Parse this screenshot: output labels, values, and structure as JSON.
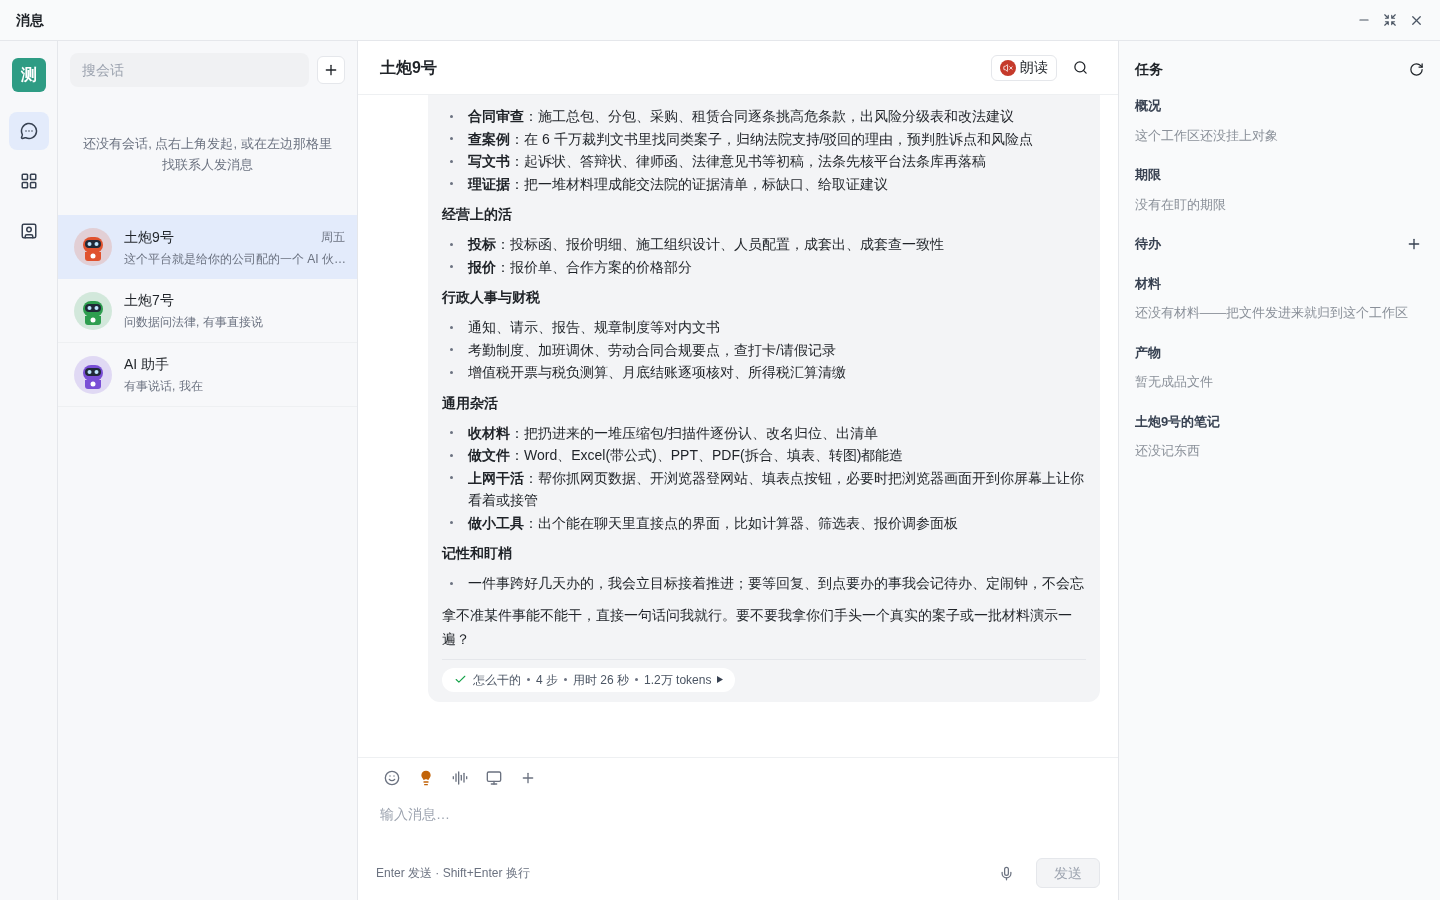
{
  "window": {
    "title": "消息"
  },
  "rail": {
    "workspace_initial": "测",
    "items": [
      {
        "selected": true
      },
      {
        "selected": false
      },
      {
        "selected": false
      }
    ]
  },
  "conversations": {
    "search": {
      "placeholder": "搜会话"
    },
    "empty_hint": "还没有会话, 点右上角发起, 或在左边那格里找联系人发消息",
    "items": [
      {
        "name": "土炮9号",
        "time": "周五",
        "preview": "这个平台就是给你的公司配的一个 AI 伙…",
        "color": "#e0522e",
        "selected": true
      },
      {
        "name": "土炮7号",
        "preview": "问数据问法律, 有事直接说",
        "color": "#2e9e4f",
        "selected": false
      },
      {
        "name": "AI 助手",
        "preview": "有事说话, 我在",
        "color": "#7a4fd6",
        "selected": false
      }
    ]
  },
  "chat": {
    "title": "土炮9号",
    "read_aloud": "朗读",
    "blocks": [
      {
        "kind": "list",
        "items": [
          "**合同审查**：施工总包、分包、采购、租赁合同逐条挑高危条款，出风险分级表和改法建议",
          "**查案例**：在 6 千万裁判文书里找同类案子，归纳法院支持/驳回的理由，预判胜诉点和风险点",
          "**写文书**：起诉状、答辩状、律师函、法律意见书等初稿，法条先核平台法条库再落稿",
          "**理证据**：把一堆材料理成能交法院的证据清单，标缺口、给取证建议"
        ]
      },
      {
        "kind": "heading",
        "text": "经营上的活"
      },
      {
        "kind": "list",
        "items": [
          "**投标**：投标函、报价明细、施工组织设计、人员配置，成套出、成套查一致性",
          "**报价**：报价单、合作方案的价格部分"
        ]
      },
      {
        "kind": "heading",
        "text": "行政人事与财税"
      },
      {
        "kind": "list",
        "items": [
          "通知、请示、报告、规章制度等对内文书",
          "考勤制度、加班调休、劳动合同合规要点，查打卡/请假记录",
          "增值税开票与税负测算、月底结账逐项核对、所得税汇算清缴"
        ]
      },
      {
        "kind": "heading",
        "text": "通用杂活"
      },
      {
        "kind": "list",
        "items": [
          "**收材料**：把扔进来的一堆压缩包/扫描件逐份认、改名归位、出清单",
          "**做文件**：Word、Excel(带公式)、PPT、PDF(拆合、填表、转图)都能造",
          "**上网干活**：帮你抓网页数据、开浏览器登网站、填表点按钮，必要时把浏览器画面开到你屏幕上让你看着或接管",
          "**做小工具**：出个能在聊天里直接点的界面，比如计算器、筛选表、报价调参面板"
        ]
      },
      {
        "kind": "heading",
        "text": "记性和盯梢"
      },
      {
        "kind": "list",
        "items": [
          "一件事跨好几天办的，我会立目标接着推进；要等回复、到点要办的事我会记待办、定闹钟，不会忘"
        ]
      },
      {
        "kind": "paragraph",
        "text": "拿不准某件事能不能干，直接一句话问我就行。要不要我拿你们手头一个真实的案子或一批材料演示一遍？"
      }
    ],
    "trace": {
      "label": "怎么干的",
      "steps": "4 步",
      "duration": "用时 26 秒",
      "tokens": "1.2万 tokens"
    },
    "composer": {
      "placeholder": "输入消息…",
      "hint": "Enter 发送 · Shift+Enter 换行",
      "send": "发送",
      "send_disabled": true
    }
  },
  "tasks": {
    "title": "任务",
    "sections": [
      {
        "title": "概况",
        "note": "这个工作区还没挂上对象",
        "addable": false
      },
      {
        "title": "期限",
        "note": "没有在盯的期限",
        "addable": false
      },
      {
        "title": "待办",
        "addable": true
      },
      {
        "title": "材料",
        "note": "还没有材料——把文件发进来就归到这个工作区",
        "addable": false
      },
      {
        "title": "产物",
        "note": "暂无成品文件",
        "addable": false
      },
      {
        "title": "土炮9号的笔记",
        "note": "还没记东西",
        "addable": false
      }
    ]
  }
}
